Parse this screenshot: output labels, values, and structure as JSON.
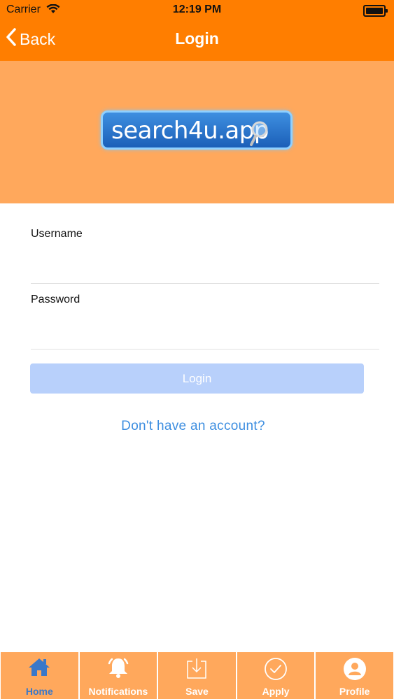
{
  "status_bar": {
    "carrier": "Carrier",
    "time": "12:19 PM"
  },
  "nav": {
    "back_label": "Back",
    "title": "Login"
  },
  "logo": {
    "text": "search4u.app"
  },
  "form": {
    "username_label": "Username",
    "username_value": "",
    "password_label": "Password",
    "password_value": "",
    "login_label": "Login",
    "signup_link": "Don't have an account?"
  },
  "tabs": [
    {
      "label": "Home",
      "icon": "home-icon",
      "active": true
    },
    {
      "label": "Notifications",
      "icon": "bell-icon",
      "active": false
    },
    {
      "label": "Save",
      "icon": "download-icon",
      "active": false
    },
    {
      "label": "Apply",
      "icon": "checkmark-circle-icon",
      "active": false
    },
    {
      "label": "Profile",
      "icon": "person-icon",
      "active": false
    }
  ],
  "colors": {
    "nav_orange": "#ff7e00",
    "banner_orange": "#ffa85c",
    "login_button": "#b8d0fb",
    "link_blue": "#3d8ee0",
    "active_tab": "#3a78c9"
  }
}
